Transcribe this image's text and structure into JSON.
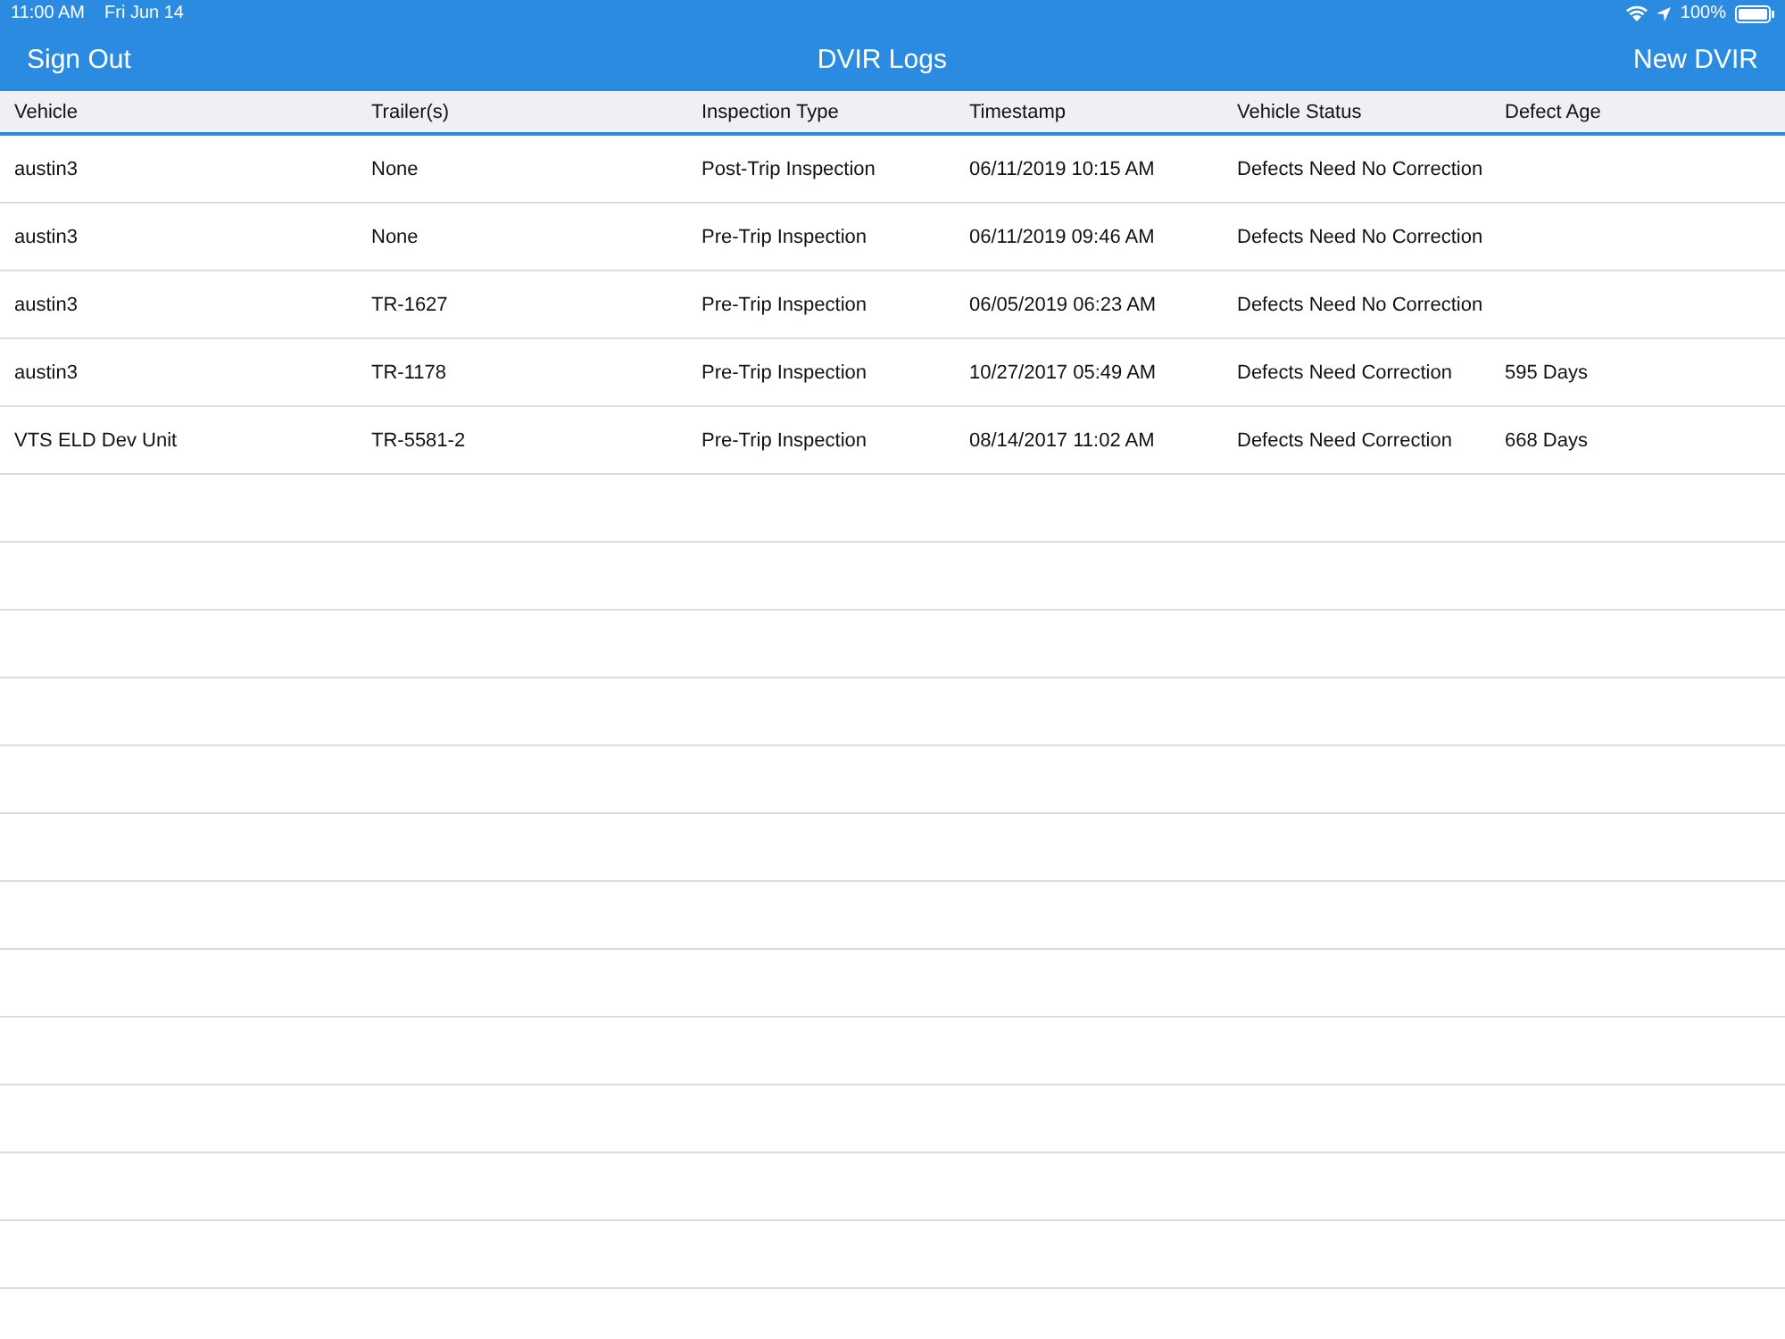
{
  "status_bar": {
    "time": "11:00 AM",
    "date": "Fri Jun 14",
    "battery": "100%"
  },
  "nav_bar": {
    "left_button": "Sign Out",
    "title": "DVIR Logs",
    "right_button": "New DVIR"
  },
  "table": {
    "columns": [
      "Vehicle",
      "Trailer(s)",
      "Inspection Type",
      "Timestamp",
      "Vehicle Status",
      "Defect Age"
    ],
    "rows": [
      {
        "vehicle": "austin3",
        "trailers": "None",
        "inspection_type": "Post-Trip Inspection",
        "timestamp": "06/11/2019 10:15 AM",
        "vehicle_status": "Defects Need No Correction"
      },
      {
        "vehicle": "austin3",
        "trailers": "None",
        "inspection_type": "Pre-Trip Inspection",
        "timestamp": "06/11/2019 09:46 AM",
        "vehicle_status": "Defects Need No Correction"
      },
      {
        "vehicle": "austin3",
        "trailers": "TR-1627",
        "inspection_type": "Pre-Trip Inspection",
        "timestamp": "06/05/2019 06:23 AM",
        "vehicle_status": "Defects Need No Correction"
      },
      {
        "vehicle": "austin3",
        "trailers": "TR-1178",
        "inspection_type": "Pre-Trip Inspection",
        "timestamp": "10/27/2017 05:49 AM",
        "vehicle_status": "Defects Need Correction",
        "defect_age": "595 Days"
      },
      {
        "vehicle": "VTS ELD Dev Unit",
        "trailers": "TR-5581-2",
        "inspection_type": "Pre-Trip Inspection",
        "timestamp": "08/14/2017 11:02 AM",
        "vehicle_status": "Defects Need Correction",
        "defect_age": "668 Days"
      }
    ]
  }
}
